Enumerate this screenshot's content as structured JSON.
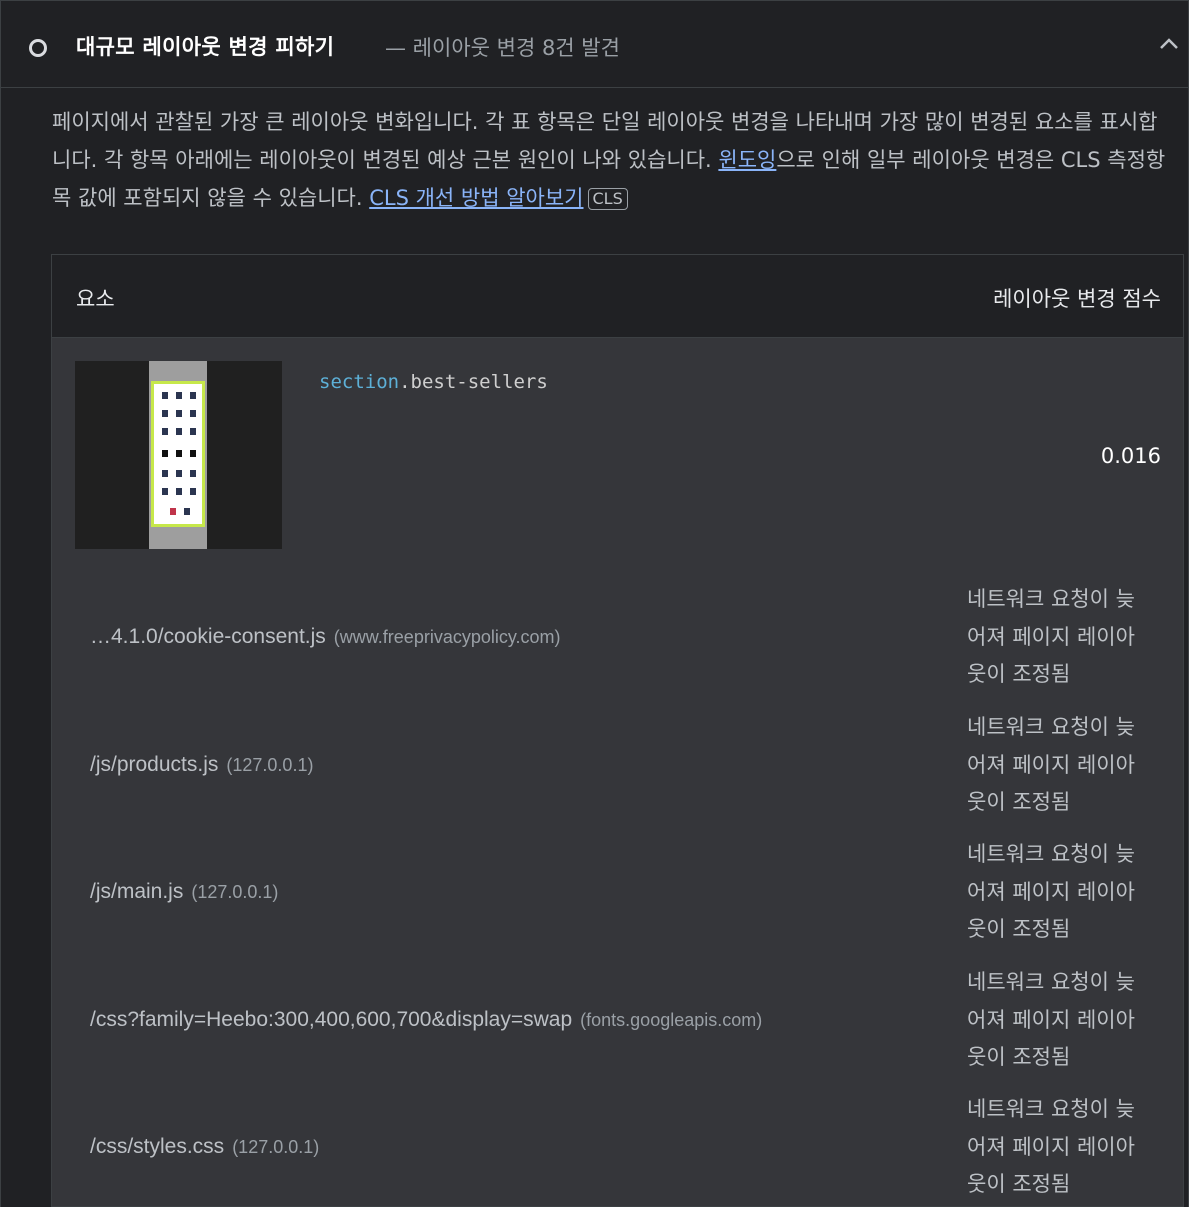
{
  "header": {
    "title": "대규모 레이아웃 변경 피하기",
    "subtitle": "— 레이아웃 변경 8건 발견"
  },
  "description": {
    "text1": "페이지에서 관찰된 가장 큰 레이아웃 변화입니다. 각 표 항목은 단일 레이아웃 변경을 나타내며 가장 많이 변경된 요소를 표시합니다. 각 항목 아래에는 레이아웃이 변경된 예상 근본 원인이 나와 있습니다. ",
    "link1": "윈도잉",
    "text2": "으로 인해 일부 레이아웃 변경은 CLS 측정항목 값에 포함되지 않을 수 있습니다. ",
    "link2": "CLS 개선 방법 알아보기",
    "badge": "CLS"
  },
  "table": {
    "col_element": "요소",
    "col_score": "레이아웃 변경 점수",
    "element": {
      "selector_tag": "section",
      "selector_class": ".best-sellers",
      "score": "0.016"
    },
    "causes": [
      {
        "url": "…4.1.0/cookie-consent.js",
        "host": "(www.freeprivacypolicy.com)",
        "reason": "네트워크 요청이 늦어져 페이지 레이아웃이 조정됨"
      },
      {
        "url": "/js/products.js",
        "host": "(127.0.0.1)",
        "reason": "네트워크 요청이 늦어져 페이지 레이아웃이 조정됨"
      },
      {
        "url": "/js/main.js",
        "host": "(127.0.0.1)",
        "reason": "네트워크 요청이 늦어져 페이지 레이아웃이 조정됨"
      },
      {
        "url": "/css?family=Heebo:300,400,600,700&display=swap",
        "host": "(fonts.googleapis.com)",
        "reason": "네트워크 요청이 늦어져 페이지 레이아웃이 조정됨"
      },
      {
        "url": "/css/styles.css",
        "host": "(127.0.0.1)",
        "reason": "네트워크 요청이 늦어져 페이지 레이아웃이 조정됨"
      }
    ]
  },
  "colors": {
    "background": "#202124",
    "table_body": "#35363a",
    "link": "#8ab4f8",
    "selector_tag": "#5db0d7",
    "highlight": "#c6e84a"
  }
}
